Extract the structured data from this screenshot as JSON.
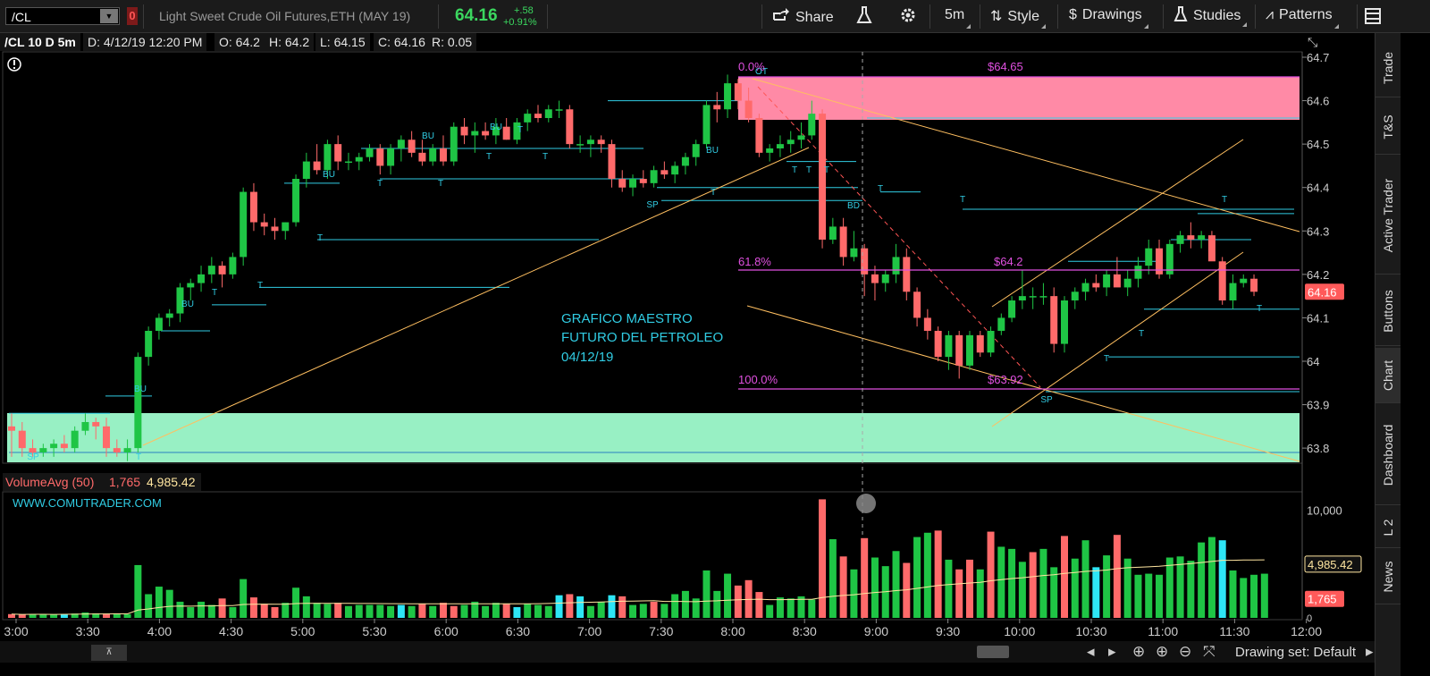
{
  "toolbar": {
    "symbol": "/CL",
    "description": "Light Sweet Crude Oil Futures,ETH (MAY 19)",
    "last_price": "64.16",
    "change": "+.58",
    "change_pct": "+0.91%",
    "share_label": "Share",
    "timeframe_label": "5m",
    "style_label": "Style",
    "drawings_label": "Drawings",
    "studies_label": "Studies",
    "patterns_label": "Patterns",
    "flag_label": "0"
  },
  "info_bar": {
    "title": "/CL 10 D 5m",
    "date": "D: 4/12/19 12:20 PM",
    "open": "O: 64.2",
    "high": "H: 64.2",
    "low": "L: 64.15",
    "close": "C: 64.16",
    "range": "R: 0.05"
  },
  "volume_bar": {
    "study": "VolumeAvg (50)",
    "volume": "1,765",
    "avg": "4,985.42"
  },
  "sidebar": {
    "tabs": [
      "Trade",
      "T&S",
      "Active Trader",
      "Buttons",
      "Chart",
      "Dashboard",
      "L 2",
      "News"
    ]
  },
  "bottom": {
    "drawing_set": "Drawing set: Default"
  },
  "annotations": {
    "main_text": [
      "GRAFICO MAESTRO",
      "FUTURO DEL PETROLEO",
      "04/12/19"
    ],
    "watermark": "WWW.COMUTRADER.COM",
    "fib_0": "0.0%",
    "fib_618": "61.8%",
    "fib_100": "100.0%",
    "price_6465": "$64.65",
    "price_642": "$64.2",
    "price_6392": "$63.92",
    "current_price_tag": "64.16",
    "vol_avg_tag": "4,985.42",
    "vol_tag": "1,765",
    "max_vol_tick": "10,000",
    "zero_vol_tick": "0"
  },
  "colors": {
    "up": "#1fc545",
    "down": "#ff6a6a",
    "cyan": "#31cde4",
    "magenta": "#e050e0",
    "supply_zone": "#ff8aa6",
    "demand_zone": "#98f0c4",
    "trend": "#ffbf60",
    "accent_green": "#3bd75f"
  },
  "chart_data": {
    "type": "candlestick",
    "y_range": [
      63.76,
      64.72
    ],
    "y_ticks": [
      "64.7",
      "64.6",
      "64.5",
      "64.4",
      "64.3",
      "64.2",
      "64.1",
      "64",
      "63.9",
      "63.8"
    ],
    "x_ticks": [
      "3:00",
      "3:30",
      "4:00",
      "4:30",
      "5:00",
      "5:30",
      "6:00",
      "6:30",
      "7:00",
      "7:30",
      "8:00",
      "8:30",
      "9:00",
      "9:30",
      "10:00",
      "10:30",
      "11:00",
      "11:30",
      "12:00"
    ],
    "volume_range": [
      0,
      11200
    ],
    "candles": [
      [
        63.85,
        63.88,
        63.78,
        63.84
      ],
      [
        63.84,
        63.86,
        63.78,
        63.8
      ],
      [
        63.8,
        63.82,
        63.78,
        63.79
      ],
      [
        63.79,
        63.81,
        63.78,
        63.8
      ],
      [
        63.8,
        63.82,
        63.78,
        63.81
      ],
      [
        63.81,
        63.83,
        63.79,
        63.8
      ],
      [
        63.8,
        63.85,
        63.79,
        63.84
      ],
      [
        63.84,
        63.88,
        63.83,
        63.86
      ],
      [
        63.86,
        63.87,
        63.82,
        63.85
      ],
      [
        63.85,
        63.87,
        63.78,
        63.8
      ],
      [
        63.8,
        63.82,
        63.78,
        63.79
      ],
      [
        63.79,
        63.82,
        63.77,
        63.8
      ],
      [
        63.8,
        64.02,
        63.79,
        64.01
      ],
      [
        64.01,
        64.08,
        63.99,
        64.07
      ],
      [
        64.07,
        64.11,
        64.05,
        64.1
      ],
      [
        64.1,
        64.12,
        64.08,
        64.11
      ],
      [
        64.11,
        64.18,
        64.09,
        64.17
      ],
      [
        64.17,
        64.19,
        64.14,
        64.18
      ],
      [
        64.18,
        64.22,
        64.16,
        64.2
      ],
      [
        64.2,
        64.24,
        64.18,
        64.22
      ],
      [
        64.22,
        64.23,
        64.17,
        64.2
      ],
      [
        64.2,
        64.25,
        64.19,
        64.24
      ],
      [
        64.24,
        64.4,
        64.22,
        64.39
      ],
      [
        64.39,
        64.41,
        64.3,
        64.32
      ],
      [
        64.32,
        64.34,
        64.29,
        64.31
      ],
      [
        64.31,
        64.33,
        64.28,
        64.3
      ],
      [
        64.3,
        64.32,
        64.28,
        64.32
      ],
      [
        64.32,
        64.43,
        64.31,
        64.42
      ],
      [
        64.42,
        64.48,
        64.4,
        64.46
      ],
      [
        64.46,
        64.5,
        64.43,
        64.44
      ],
      [
        64.44,
        64.51,
        64.42,
        64.5
      ],
      [
        64.5,
        64.52,
        64.44,
        64.46
      ],
      [
        64.46,
        64.48,
        64.44,
        64.46
      ],
      [
        64.46,
        64.48,
        64.44,
        64.47
      ],
      [
        64.47,
        64.5,
        64.46,
        64.49
      ],
      [
        64.49,
        64.5,
        64.43,
        64.45
      ],
      [
        64.45,
        64.5,
        64.43,
        64.49
      ],
      [
        64.49,
        64.52,
        64.46,
        64.51
      ],
      [
        64.51,
        64.53,
        64.47,
        64.48
      ],
      [
        64.48,
        64.51,
        64.45,
        64.46
      ],
      [
        64.46,
        64.5,
        64.45,
        64.49
      ],
      [
        64.49,
        64.52,
        64.45,
        64.46
      ],
      [
        64.46,
        64.55,
        64.45,
        64.54
      ],
      [
        64.54,
        64.56,
        64.5,
        64.52
      ],
      [
        64.52,
        64.55,
        64.48,
        64.53
      ],
      [
        64.53,
        64.55,
        64.51,
        64.52
      ],
      [
        64.52,
        64.56,
        64.5,
        64.54
      ],
      [
        64.54,
        64.56,
        64.51,
        64.51
      ],
      [
        64.51,
        64.56,
        64.5,
        64.55
      ],
      [
        64.55,
        64.58,
        64.53,
        64.57
      ],
      [
        64.57,
        64.59,
        64.55,
        64.56
      ],
      [
        64.56,
        64.59,
        64.55,
        64.58
      ],
      [
        64.58,
        64.6,
        64.56,
        64.58
      ],
      [
        64.58,
        64.59,
        64.49,
        64.5
      ],
      [
        64.5,
        64.52,
        64.48,
        64.5
      ],
      [
        64.5,
        64.52,
        64.47,
        64.51
      ],
      [
        64.51,
        64.52,
        64.48,
        64.5
      ],
      [
        64.5,
        64.51,
        64.4,
        64.42
      ],
      [
        64.42,
        64.44,
        64.39,
        64.4
      ],
      [
        64.4,
        64.43,
        64.38,
        64.42
      ],
      [
        64.42,
        64.44,
        64.4,
        64.41
      ],
      [
        64.41,
        64.45,
        64.4,
        64.44
      ],
      [
        64.44,
        64.46,
        64.42,
        64.43
      ],
      [
        64.43,
        64.46,
        64.41,
        64.45
      ],
      [
        64.45,
        64.48,
        64.43,
        64.47
      ],
      [
        64.47,
        64.51,
        64.45,
        64.5
      ],
      [
        64.5,
        64.6,
        64.49,
        64.59
      ],
      [
        64.59,
        64.62,
        64.55,
        64.58
      ],
      [
        64.58,
        64.66,
        64.56,
        64.64
      ],
      [
        64.64,
        64.65,
        64.58,
        64.6
      ],
      [
        64.6,
        64.63,
        64.55,
        64.56
      ],
      [
        64.56,
        64.57,
        64.47,
        64.48
      ],
      [
        64.48,
        64.5,
        64.46,
        64.49
      ],
      [
        64.49,
        64.52,
        64.47,
        64.5
      ],
      [
        64.5,
        64.53,
        64.48,
        64.51
      ],
      [
        64.51,
        64.55,
        64.49,
        64.52
      ],
      [
        64.52,
        64.6,
        64.51,
        64.57
      ],
      [
        64.57,
        64.58,
        64.26,
        64.28
      ],
      [
        64.28,
        64.33,
        64.27,
        64.31
      ],
      [
        64.31,
        64.33,
        64.22,
        64.24
      ],
      [
        64.24,
        64.3,
        64.23,
        64.26
      ],
      [
        64.26,
        64.27,
        64.15,
        64.2
      ],
      [
        64.2,
        64.22,
        64.14,
        64.18
      ],
      [
        64.18,
        64.21,
        64.16,
        64.2
      ],
      [
        64.2,
        64.27,
        64.18,
        64.24
      ],
      [
        64.24,
        64.26,
        64.14,
        64.16
      ],
      [
        64.16,
        64.17,
        64.08,
        64.1
      ],
      [
        64.1,
        64.12,
        64.05,
        64.07
      ],
      [
        64.07,
        64.08,
        64.0,
        64.01
      ],
      [
        64.01,
        64.07,
        63.98,
        64.06
      ],
      [
        64.06,
        64.07,
        63.96,
        63.99
      ],
      [
        63.99,
        64.07,
        63.98,
        64.06
      ],
      [
        64.06,
        64.07,
        64.01,
        64.02
      ],
      [
        64.02,
        64.08,
        64.01,
        64.07
      ],
      [
        64.07,
        64.11,
        64.06,
        64.1
      ],
      [
        64.1,
        64.15,
        64.09,
        64.14
      ],
      [
        64.14,
        64.21,
        64.12,
        64.15
      ],
      [
        64.15,
        64.17,
        64.12,
        64.15
      ],
      [
        64.15,
        64.18,
        64.13,
        64.15
      ],
      [
        64.15,
        64.17,
        64.02,
        64.04
      ],
      [
        64.04,
        64.15,
        64.02,
        64.14
      ],
      [
        64.14,
        64.17,
        64.12,
        64.16
      ],
      [
        64.16,
        64.19,
        64.14,
        64.18
      ],
      [
        64.18,
        64.2,
        64.16,
        64.17
      ],
      [
        64.17,
        64.21,
        64.15,
        64.2
      ],
      [
        64.2,
        64.24,
        64.18,
        64.17
      ],
      [
        64.17,
        64.21,
        64.15,
        64.19
      ],
      [
        64.19,
        64.24,
        64.17,
        64.22
      ],
      [
        64.22,
        64.28,
        64.2,
        64.26
      ],
      [
        64.26,
        64.28,
        64.19,
        64.2
      ],
      [
        64.2,
        64.28,
        64.19,
        64.27
      ],
      [
        64.27,
        64.3,
        64.25,
        64.29
      ],
      [
        64.29,
        64.32,
        64.26,
        64.28
      ],
      [
        64.28,
        64.3,
        64.26,
        64.29
      ],
      [
        64.29,
        64.3,
        64.24,
        64.23
      ],
      [
        64.23,
        64.24,
        64.13,
        64.14
      ],
      [
        64.14,
        64.2,
        64.12,
        64.18
      ],
      [
        64.18,
        64.2,
        64.17,
        64.19
      ],
      [
        64.19,
        64.2,
        64.15,
        64.16
      ]
    ],
    "volumes": [
      [
        350,
        "down"
      ],
      [
        300,
        "down"
      ],
      [
        350,
        "up"
      ],
      [
        320,
        "up"
      ],
      [
        300,
        "up"
      ],
      [
        350,
        "cyan"
      ],
      [
        400,
        "up"
      ],
      [
        500,
        "up"
      ],
      [
        420,
        "up"
      ],
      [
        400,
        "down"
      ],
      [
        420,
        "up"
      ],
      [
        350,
        "up"
      ],
      [
        4900,
        "up"
      ],
      [
        2200,
        "up"
      ],
      [
        2900,
        "up"
      ],
      [
        2600,
        "up"
      ],
      [
        1500,
        "up"
      ],
      [
        1000,
        "up"
      ],
      [
        1500,
        "up"
      ],
      [
        1200,
        "up"
      ],
      [
        1800,
        "down"
      ],
      [
        1000,
        "up"
      ],
      [
        3600,
        "up"
      ],
      [
        1900,
        "down"
      ],
      [
        1300,
        "down"
      ],
      [
        1000,
        "down"
      ],
      [
        1400,
        "up"
      ],
      [
        2800,
        "up"
      ],
      [
        2000,
        "up"
      ],
      [
        1400,
        "up"
      ],
      [
        1300,
        "up"
      ],
      [
        1400,
        "down"
      ],
      [
        1100,
        "up"
      ],
      [
        1200,
        "up"
      ],
      [
        1200,
        "up"
      ],
      [
        1200,
        "up"
      ],
      [
        1100,
        "up"
      ],
      [
        1200,
        "cyan"
      ],
      [
        1100,
        "up"
      ],
      [
        1300,
        "down"
      ],
      [
        1100,
        "up"
      ],
      [
        1400,
        "down"
      ],
      [
        1100,
        "down"
      ],
      [
        1200,
        "up"
      ],
      [
        1500,
        "up"
      ],
      [
        1100,
        "up"
      ],
      [
        1400,
        "up"
      ],
      [
        1300,
        "down"
      ],
      [
        1000,
        "cyan"
      ],
      [
        1300,
        "up"
      ],
      [
        1200,
        "up"
      ],
      [
        1100,
        "up"
      ],
      [
        2100,
        "cyan"
      ],
      [
        2200,
        "down"
      ],
      [
        2000,
        "cyan"
      ],
      [
        1100,
        "up"
      ],
      [
        1500,
        "up"
      ],
      [
        2100,
        "cyan"
      ],
      [
        2000,
        "down"
      ],
      [
        1200,
        "up"
      ],
      [
        1300,
        "up"
      ],
      [
        1500,
        "down"
      ],
      [
        1300,
        "up"
      ],
      [
        2200,
        "up"
      ],
      [
        2500,
        "up"
      ],
      [
        1800,
        "up"
      ],
      [
        4400,
        "up"
      ],
      [
        2500,
        "up"
      ],
      [
        4100,
        "up"
      ],
      [
        3000,
        "down"
      ],
      [
        3500,
        "down"
      ],
      [
        2400,
        "down"
      ],
      [
        1200,
        "up"
      ],
      [
        1900,
        "up"
      ],
      [
        1800,
        "up"
      ],
      [
        2000,
        "up"
      ],
      [
        1700,
        "up"
      ],
      [
        11000,
        "down"
      ],
      [
        7300,
        "up"
      ],
      [
        5700,
        "down"
      ],
      [
        4500,
        "up"
      ],
      [
        7400,
        "down"
      ],
      [
        5600,
        "up"
      ],
      [
        4800,
        "up"
      ],
      [
        6200,
        "up"
      ],
      [
        5100,
        "down"
      ],
      [
        7500,
        "up"
      ],
      [
        7900,
        "up"
      ],
      [
        8100,
        "down"
      ],
      [
        5400,
        "up"
      ],
      [
        4500,
        "down"
      ],
      [
        5400,
        "down"
      ],
      [
        4500,
        "up"
      ],
      [
        8000,
        "down"
      ],
      [
        6600,
        "up"
      ],
      [
        6400,
        "up"
      ],
      [
        5200,
        "up"
      ],
      [
        6100,
        "down"
      ],
      [
        6400,
        "up"
      ],
      [
        4700,
        "up"
      ],
      [
        7600,
        "down"
      ],
      [
        5500,
        "up"
      ],
      [
        7200,
        "up"
      ],
      [
        4700,
        "cyan"
      ],
      [
        5800,
        "up"
      ],
      [
        7700,
        "down"
      ],
      [
        5500,
        "up"
      ],
      [
        4000,
        "up"
      ],
      [
        4100,
        "up"
      ],
      [
        4000,
        "up"
      ],
      [
        5600,
        "up"
      ],
      [
        5700,
        "up"
      ],
      [
        5300,
        "up"
      ],
      [
        7000,
        "up"
      ],
      [
        7500,
        "up"
      ],
      [
        7200,
        "cyan"
      ],
      [
        4400,
        "up"
      ],
      [
        3700,
        "up"
      ],
      [
        4000,
        "up"
      ],
      [
        4100,
        "up"
      ]
    ]
  }
}
